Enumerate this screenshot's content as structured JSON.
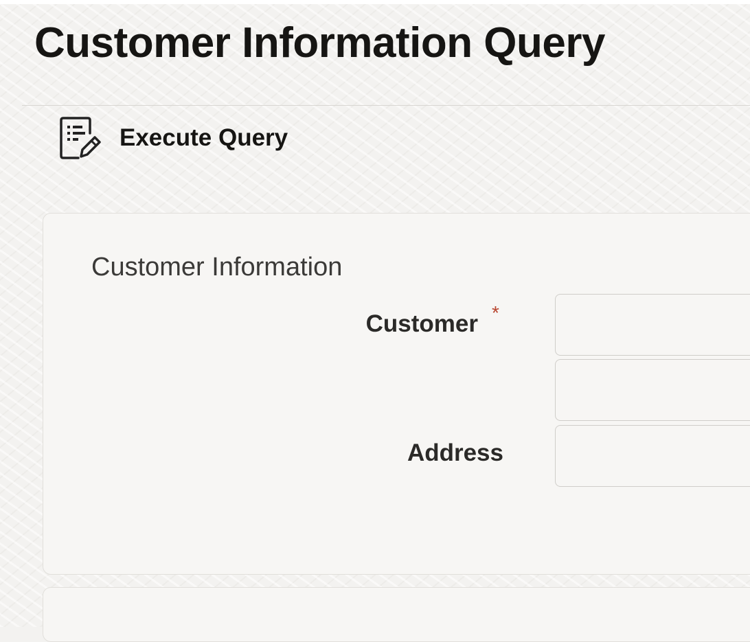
{
  "page": {
    "title": "Customer Information Query"
  },
  "toolbar": {
    "execute_query": {
      "label": "Execute Query",
      "icon": "query-edit-icon"
    }
  },
  "customer_information": {
    "section_title": "Customer Information",
    "fields": {
      "customer": {
        "label": "Customer",
        "required_mark": "*",
        "value": ""
      },
      "customer_name": {
        "value": ""
      },
      "address": {
        "label": "Address",
        "value": ""
      }
    }
  },
  "colors": {
    "required": "#b8452f",
    "text": "#161513"
  }
}
